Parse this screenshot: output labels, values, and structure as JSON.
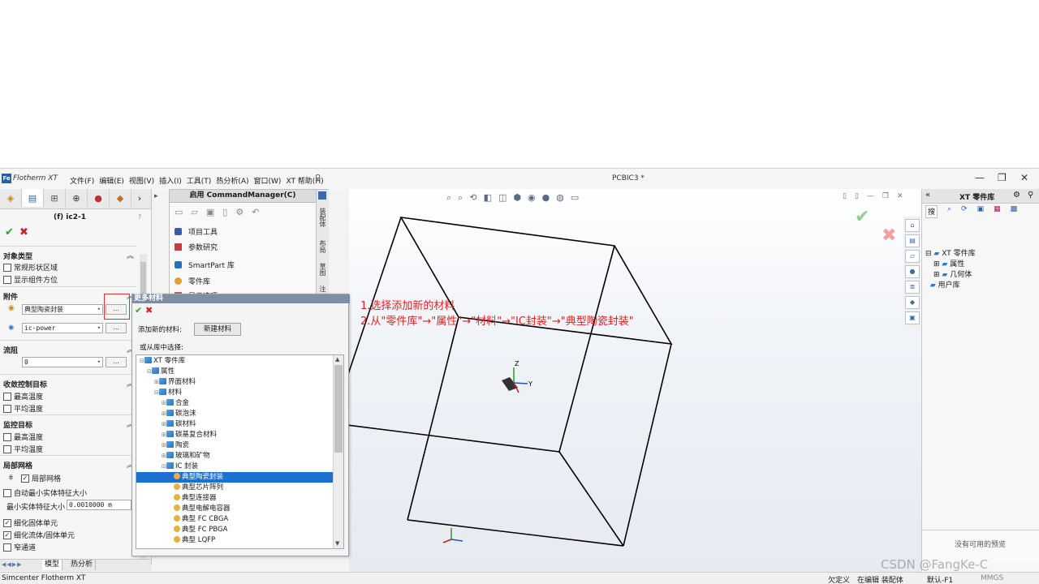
{
  "app": {
    "logo_badge": "Fe",
    "logo_text": "Flotherm XT",
    "document_title": "PCBIC3 *",
    "menu": [
      "文件(F)",
      "编辑(E)",
      "视图(V)",
      "插入(I)",
      "工具(T)",
      "热分析(A)",
      "窗口(W)",
      "XT 帮助(H)"
    ]
  },
  "left_panel": {
    "title": "(f) ic2-1",
    "help": "?",
    "sections": {
      "object_type": "对象类型",
      "attachment": "附件",
      "flow_resistance": "流阻",
      "convergence": "收敛控制目标",
      "monitor": "监控目标",
      "local_mesh": "局部网格"
    },
    "object_type_options": [
      "常规形状区域",
      "显示组件方位"
    ],
    "attachments": [
      {
        "value": "典型陶瓷封装",
        "button": "..."
      },
      {
        "value": "ic-power",
        "button": "..."
      }
    ],
    "flow_resistance_value": "0",
    "convergence_options": [
      "最高温度",
      "平均温度"
    ],
    "monitor_options": [
      "最高温度",
      "平均温度"
    ],
    "local_mesh": {
      "local_mesh_label": "局部网格",
      "auto_min_feature": "自动最小实体特征大小",
      "min_feature_label": "最小实体特征大小",
      "min_feature_value": "0.0010000 m",
      "refine_solid": "细化固体单元",
      "refine_fluid_solid": "细化流体/固体单元",
      "narrow_channel": "窄通道"
    },
    "bottom_tabs": [
      "模型",
      "热分析"
    ]
  },
  "command_manager": {
    "title": "启用 CommandManager(C)",
    "items": [
      "项目工具",
      "参数研究",
      "SmartPart 库",
      "零件库",
      "显示选项"
    ],
    "vertical_tabs": [
      "装配体",
      "布局",
      "草图",
      "注"
    ]
  },
  "dialog": {
    "title": "更多材料",
    "add_label": "添加新的材料:",
    "new_material_button": "新建材料",
    "from_library_label": "或从库中选择:",
    "tree": [
      {
        "label": "XT 零件库",
        "level": 0,
        "icon": "folder",
        "expand": "-"
      },
      {
        "label": "属性",
        "level": 1,
        "icon": "folder",
        "expand": "-"
      },
      {
        "label": "界面材料",
        "level": 2,
        "icon": "folder",
        "expand": "+"
      },
      {
        "label": "材料",
        "level": 2,
        "icon": "folder",
        "expand": "-"
      },
      {
        "label": "合金",
        "level": 3,
        "icon": "folder",
        "expand": "+"
      },
      {
        "label": "碳泡沫",
        "level": 3,
        "icon": "folder",
        "expand": "+"
      },
      {
        "label": "碳材料",
        "level": 3,
        "icon": "folder",
        "expand": "+"
      },
      {
        "label": "碳基复合材料",
        "level": 3,
        "icon": "folder",
        "expand": "+"
      },
      {
        "label": "陶瓷",
        "level": 3,
        "icon": "folder",
        "expand": "+"
      },
      {
        "label": "玻璃和矿物",
        "level": 3,
        "icon": "folder",
        "expand": "+"
      },
      {
        "label": "IC 封装",
        "level": 3,
        "icon": "folder",
        "expand": "-"
      },
      {
        "label": "典型陶瓷封装",
        "level": 4,
        "icon": "mat",
        "expand": "",
        "selected": true
      },
      {
        "label": "典型芯片阵列",
        "level": 4,
        "icon": "mat",
        "expand": ""
      },
      {
        "label": "典型连接器",
        "level": 4,
        "icon": "mat",
        "expand": ""
      },
      {
        "label": "典型电解电容器",
        "level": 4,
        "icon": "mat",
        "expand": ""
      },
      {
        "label": "典型 FC CBGA",
        "level": 4,
        "icon": "mat",
        "expand": ""
      },
      {
        "label": "典型 FC PBGA",
        "level": 4,
        "icon": "mat",
        "expand": ""
      },
      {
        "label": "典型 LQFP",
        "level": 4,
        "icon": "mat",
        "expand": ""
      }
    ]
  },
  "annotation": {
    "line1": "1.选择添加新的材料",
    "line2": "2.从\"零件库\"→\"属性\"→\"材料\"→\"IC封装\"→\"典型陶瓷封装\""
  },
  "viewport": {
    "axis_z": "Z",
    "axis_y": "Y"
  },
  "right_panel": {
    "title": "XT 零件库",
    "search_tab": "搜",
    "tree": [
      "XT 零件库",
      "属性",
      "几何体",
      "用户库"
    ],
    "preview_text": "没有可用的预览"
  },
  "status_bar": {
    "app_name": "Simcenter Flotherm XT",
    "undefined": "欠定义",
    "editing": "在编辑 装配体",
    "default": "默认-F1",
    "units": "MMGS"
  },
  "watermark": "CSDN @FangKe-C",
  "colors": {
    "annotation_red": "#e02020",
    "selection_blue": "#1f6fd0",
    "dialog_title": "#7f8ea4"
  }
}
